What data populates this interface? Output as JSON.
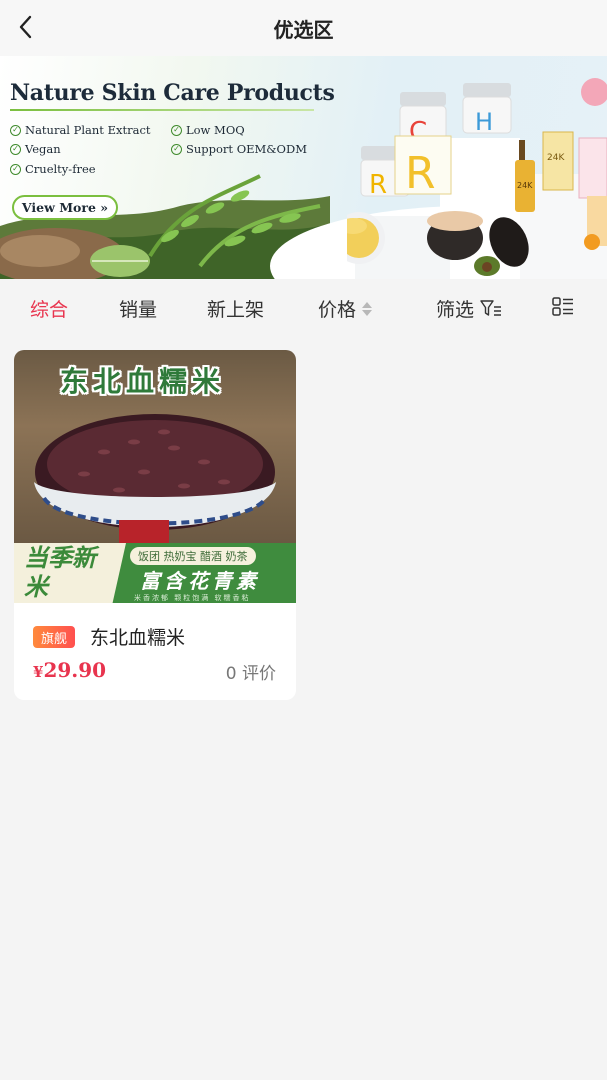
{
  "header": {
    "title": "优选区",
    "back_icon": "chevron-left-icon"
  },
  "banner": {
    "title": "Nature Skin Care Products",
    "features": [
      "Natural Plant Extract",
      "Low MOQ",
      "Vegan",
      "Support OEM&ODM",
      "Cruelty-free"
    ],
    "cta": "View More »",
    "jar_labels": [
      "C",
      "H",
      "R",
      "R",
      "24K",
      "24K"
    ],
    "colors": {
      "accent_green": "#7bbf3f"
    }
  },
  "tabs": [
    {
      "label": "综合",
      "active": true
    },
    {
      "label": "销量",
      "active": false
    },
    {
      "label": "新上架",
      "active": false
    },
    {
      "label": "价格",
      "active": false,
      "icon": "sort-arrows-icon"
    },
    {
      "label": "筛选",
      "active": false,
      "icon": "filter-icon"
    }
  ],
  "layout_toggle_icon": "list-layout-icon",
  "products": [
    {
      "image": {
        "title": "东北血糯米",
        "season": "当季新米",
        "tags": "饭团 热奶宝 醋酒 奶茶",
        "slogan": "富含花青素",
        "fine_print": "米香浓郁 颗粒饱满 软糯香粘"
      },
      "badge": "旗舰",
      "name": "东北血糯米",
      "currency": "¥",
      "price": "29.90",
      "reviews": "0 评价"
    }
  ],
  "colors": {
    "brand_red": "#e8344e",
    "badge_gradient": [
      "#ff8a3c",
      "#ff4f4f"
    ]
  }
}
